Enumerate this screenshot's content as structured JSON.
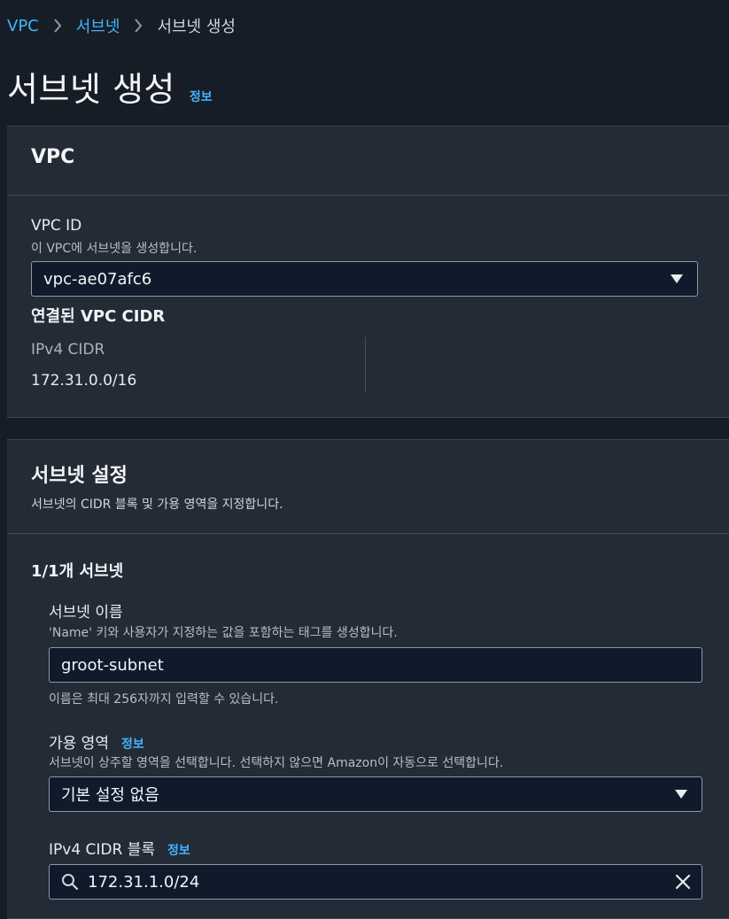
{
  "breadcrumb": {
    "items": [
      "VPC",
      "서브넷",
      "서브넷 생성"
    ]
  },
  "page": {
    "title": "서브넷 생성",
    "info_link": "정보"
  },
  "vpc_panel": {
    "title": "VPC",
    "vpc_id_label": "VPC ID",
    "vpc_id_description": "이 VPC에 서브넷을 생성합니다.",
    "vpc_id_value": "vpc-ae07afc6",
    "associated_cidr_heading": "연결된 VPC CIDR",
    "ipv4_cidr_label": "IPv4 CIDR",
    "ipv4_cidr_value": "172.31.0.0/16"
  },
  "subnet_panel": {
    "title": "서브넷 설정",
    "description": "서브넷의 CIDR 블록 및 가용 영역을 지정합니다.",
    "subnet_count_heading": "1/1개 서브넷",
    "name_label": "서브넷 이름",
    "name_description": "'Name' 키와 사용자가 지정하는 값을 포함하는 태그를 생성합니다.",
    "name_value": "groot-subnet",
    "name_hint": "이름은 최대 256자까지 입력할 수 있습니다.",
    "az_label": "가용 영역",
    "az_info_link": "정보",
    "az_description": "서브넷이 상주할 영역을 선택합니다. 선택하지 않으면 Amazon이 자동으로 선택합니다.",
    "az_value": "기본 설정 없음",
    "cidr_label": "IPv4 CIDR 블록",
    "cidr_info_link": "정보",
    "cidr_value": "172.31.1.0/24"
  },
  "colors": {
    "background": "#161d26",
    "panel": "#232b37",
    "link": "#42b4ff",
    "input_bg": "#0f1b2a"
  },
  "icons": [
    "chevron-right-icon",
    "caret-down-icon",
    "search-icon",
    "close-icon"
  ]
}
